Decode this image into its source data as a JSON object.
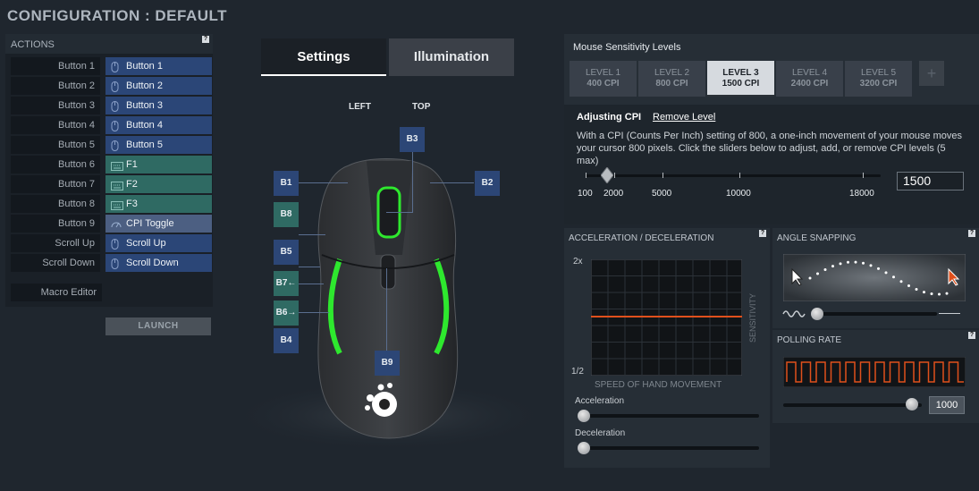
{
  "title": "CONFIGURATION : DEFAULT",
  "actions": {
    "header": "ACTIONS",
    "help": "?",
    "rows": [
      {
        "label": "Button 1",
        "value": "Button 1",
        "kind": "blue",
        "icon": "mouse-icon"
      },
      {
        "label": "Button 2",
        "value": "Button 2",
        "kind": "blue",
        "icon": "mouse-icon"
      },
      {
        "label": "Button 3",
        "value": "Button 3",
        "kind": "blue",
        "icon": "mouse-icon"
      },
      {
        "label": "Button 4",
        "value": "Button 4",
        "kind": "blue",
        "icon": "mouse-icon"
      },
      {
        "label": "Button 5",
        "value": "Button 5",
        "kind": "blue",
        "icon": "mouse-icon"
      },
      {
        "label": "Button 6",
        "value": "F1",
        "kind": "teal",
        "icon": "keyboard-icon"
      },
      {
        "label": "Button 7",
        "value": "F2",
        "kind": "teal",
        "icon": "keyboard-icon"
      },
      {
        "label": "Button 8",
        "value": "F3",
        "kind": "teal",
        "icon": "keyboard-icon"
      },
      {
        "label": "Button 9",
        "value": "CPI Toggle",
        "kind": "grey",
        "icon": "gauge-icon"
      },
      {
        "label": "Scroll Up",
        "value": "Scroll Up",
        "kind": "blue",
        "icon": "mouse-icon"
      },
      {
        "label": "Scroll Down",
        "value": "Scroll Down",
        "kind": "blue",
        "icon": "mouse-icon"
      }
    ],
    "macro_label": "Macro Editor",
    "launch_label": "LAUNCH"
  },
  "tabs": {
    "settings": "Settings",
    "illumination": "Illumination"
  },
  "mouse_view": {
    "left_label": "LEFT",
    "top_label": "TOP",
    "buttons": {
      "b1": "B1",
      "b2": "B2",
      "b3": "B3",
      "b4": "B4",
      "b5": "B5",
      "b6": "B6",
      "b7": "B7",
      "b8": "B8",
      "b9": "B9"
    },
    "accent_color": "#2ee82e"
  },
  "sensitivity": {
    "title": "Mouse Sensitivity Levels",
    "levels": [
      {
        "name": "LEVEL 1",
        "cpi": "400 CPI"
      },
      {
        "name": "LEVEL 2",
        "cpi": "800 CPI"
      },
      {
        "name": "LEVEL 3",
        "cpi": "1500 CPI"
      },
      {
        "name": "LEVEL 4",
        "cpi": "2400 CPI"
      },
      {
        "name": "LEVEL 5",
        "cpi": "3200 CPI"
      }
    ],
    "active_level": 3,
    "add_label": "+",
    "adjusting_label": "Adjusting CPI",
    "remove_label": "Remove Level",
    "description": "With a CPI (Counts Per Inch) setting of 800, a one-inch movement of your mouse moves your cursor 800 pixels. Click the sliders below to adjust, add, or remove CPI levels (5 max)",
    "ticks": [
      "100",
      "2000",
      "5000",
      "10000",
      "18000"
    ],
    "cpi_value": "1500"
  },
  "acceleration": {
    "title": "ACCELERATION / DECELERATION",
    "help": "?",
    "y_top": "2x",
    "y_bottom": "1/2",
    "x_axis": "SPEED OF HAND MOVEMENT",
    "y_axis": "SENSITIVITY",
    "accel_label": "Acceleration",
    "decel_label": "Deceleration",
    "line_color": "#e0501c"
  },
  "angle_snapping": {
    "title": "ANGLE SNAPPING",
    "help": "?"
  },
  "polling": {
    "title": "POLLING RATE",
    "help": "?",
    "value": "1000",
    "wave_color": "#e0501c"
  }
}
